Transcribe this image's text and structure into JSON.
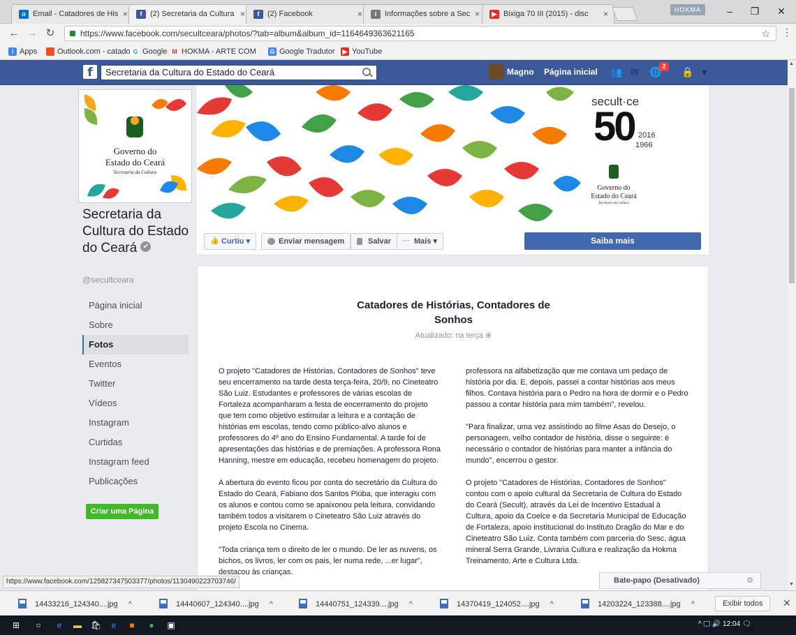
{
  "browser": {
    "tabs": [
      {
        "title": "Email - Catadores de His",
        "icon": "outlook-icon",
        "color": "#0072c6",
        "glyph": "o"
      },
      {
        "title": "(2) Secretaria da Cultura",
        "icon": "facebook-icon",
        "color": "#3b5998",
        "glyph": "f"
      },
      {
        "title": "(2) Facebook",
        "icon": "facebook-icon",
        "color": "#3b5998",
        "glyph": "f"
      },
      {
        "title": "Informações sobre a Sec",
        "icon": "info-icon",
        "color": "#777777",
        "glyph": "i"
      },
      {
        "title": "Bixiga 70 III (2015) - disc",
        "icon": "youtube-icon",
        "color": "#e52d27",
        "glyph": "▶"
      }
    ],
    "profile_label": "HOKMA",
    "url": "https://www.facebook.com/secultceara/photos/?tab=album&album_id=1164649363621165",
    "bookmarks": [
      {
        "label": "Apps",
        "icon": "apps-icon",
        "color": "#4285f4"
      },
      {
        "label": "Outlook.com - catado",
        "icon": "outlook-icon",
        "color": "#f25022"
      },
      {
        "label": "Google",
        "icon": "google-icon",
        "color": "#ffffff"
      },
      {
        "label": "HOKMA - ARTE COM",
        "icon": "gmail-icon",
        "color": "#ffffff"
      },
      {
        "label": "Google Tradutor",
        "icon": "translate-icon",
        "color": "#4285f4"
      },
      {
        "label": "YouTube",
        "icon": "youtube-icon",
        "color": "#e52d27"
      }
    ]
  },
  "fb": {
    "search_value": "Secretaria da Cultura do Estado do Ceará",
    "user_name": "Magno",
    "home_label": "Página inicial",
    "notif_count": "2"
  },
  "page": {
    "gov_line1": "Governo do",
    "gov_line2": "Estado do Ceará",
    "gov_line3": "Secretaria da Cultura",
    "name": "Secretaria da Cultura do Estado do Ceará",
    "handle": "@secultceara",
    "nav": [
      "Página inicial",
      "Sobre",
      "Fotos",
      "Eventos",
      "Twitter",
      "Vídeos",
      "Instagram",
      "Curtidas",
      "Instagram feed",
      "Publicações"
    ],
    "active_nav": "Fotos",
    "create_page": "Criar uma Página"
  },
  "cover": {
    "brand": "secult·ce",
    "big_number": "50",
    "year_top": "2016",
    "year_bottom": "1966",
    "gov_line1": "Governo do",
    "gov_line2": "Estado do Ceará",
    "gov_line3": "Secretaria da Cultura"
  },
  "actions": {
    "like": "Curtiu",
    "message": "Enviar mensagem",
    "save": "Salvar",
    "more": "Mais",
    "learn_more": "Saiba mais"
  },
  "album": {
    "title": "Catadores de Histórias, Contadores de Sonhos",
    "updated": "Atualizado: na terça",
    "left_paragraphs": [
      "O projeto \"Catadores de Histórias, Contadores de Sonhos\" teve seu encerramento na tarde desta terça-feira, 20/9, no Cineteatro São Luiz. Estudantes e professores de várias escolas de Fortaleza acompanharam a festa de encerramento do projeto que tem como objetivo estimular a leitura e a contação de histórias em escolas, tendo como público-alvo alunos e professores do 4º ano do Ensino Fundamental. A tarde foi de apresentações das histórias e de premiações. A professora Rona Hanning, mestre em educação, recebeu homenagem do projeto.",
      "A abertura do evento ficou por conta do secretário da Cultura do Estado do Ceará, Fabiano dos Santos Piúba, que interagiu com os alunos e contou como se apaixonou pela leitura, convidando também todos a visitarem o Cineteatro São Luiz através do projeto Escola no Cinema.",
      "\"Toda criança tem o direito de ler o mundo. De ler as nuvens, os bichos, os livros, ler com os pais, ler numa rede, ...er lugar\", destacou às crianças."
    ],
    "right_paragraphs": [
      "professora na alfabetização que me contava um pedaço de história por dia. E, depois, passei a contar histórias aos meus filhos. Contava história para o Pedro na hora de dormir e o Pedro passou a contar história para mim também\", revelou.",
      "\"Para finalizar, uma vez assistindo ao filme Asas do Desejo, o personagem, velho contador de história, disse o seguinte: é necessário o contador de histórias para manter a infância do mundo\", encerrou o gestor.",
      "O projeto \"Catadores de Histórias, Contadores de Sonhos\" contou com o apoio cultural da Secretaria de Cultura do Estado do Ceará (Secult), através da Lei de Incentivo Estadual à Cultura, apoio da Coelce e da Secretaria Municipal de Educação de Fortaleza, apoio institucional do Instituto Dragão do Mar e do Cineteatro São Luiz. Conta também com parceria do Sesc, água mineral Serra Grande, Livraria Cultura e realização da Hokma Treinamento, Arte e Cultura Ltda."
    ]
  },
  "status_url": "https://www.facebook.com/125827347503377/photos/1130490223703746/",
  "chat_label": "Bate-papo (Desativado)",
  "downloads": {
    "files": [
      "14433216_124340....jpg",
      "14440607_124340....jpg",
      "14440751_124339....jpg",
      "14370419_124052....jpg",
      "14203224_123388....jpg"
    ],
    "show_all": "Exibir todos"
  },
  "tray": {
    "time": "12:04"
  }
}
